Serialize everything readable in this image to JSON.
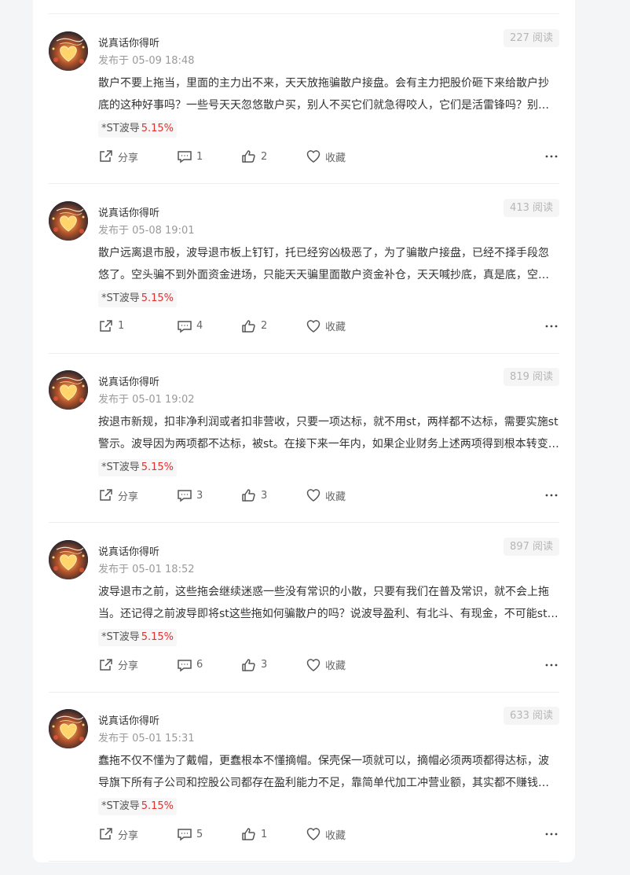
{
  "posts": [
    {
      "author": "说真话你得听",
      "time": "发布于 05-09 18:48",
      "reads": "227 阅读",
      "line1": "散户不要上拖当，里面的主力出不来，天天放拖骗散户接盘。会有主力把股价砸下来给散户抄",
      "line2": "底的这种好事吗？一些号天天忽悠散户买，别人不买它们就急得咬人，它们是活雷锋吗？别人不买它们",
      "stock": "*ST波导",
      "pct": "5.15%",
      "share": "分享",
      "comments": "1",
      "likes": "2",
      "collect": "收藏"
    },
    {
      "author": "说真话你得听",
      "time": "发布于 05-08 19:01",
      "reads": "413 阅读",
      "line1": "散户远离退市股，波导退市板上钉钉，托已经穷凶极恶了，为了骗散户接盘，已经不择手段忽",
      "line2": "悠了。空头骗不到外面资金进场，只能天天骗里面散户资金补仓，天天喊抄底，真是底，空头自己",
      "stock": "*ST波导",
      "pct": "5.15%",
      "share": "1",
      "comments": "4",
      "likes": "2",
      "collect": "收藏"
    },
    {
      "author": "说真话你得听",
      "time": "发布于 05-01 19:02",
      "reads": "819 阅读",
      "line1": "按退市新规，扣非净利润或者扣非营收，只要一项达标，就不用st，两样都不达标，需要实施st",
      "line2": "警示。波导因为两项都不达标，被st。在接下来一年内，如果企业财务上述两项得到根本转变，才能",
      "stock": "*ST波导",
      "pct": "5.15%",
      "share": "分享",
      "comments": "3",
      "likes": "3",
      "collect": "收藏"
    },
    {
      "author": "说真话你得听",
      "time": "发布于 05-01 18:52",
      "reads": "897 阅读",
      "line1": "波导退市之前，这些拖会继续迷惑一些没有常识的小散，只要有我们在普及常识，就不会上拖",
      "line2": "当。还记得之前波导即将st这些拖如何骗散户的吗？说波导盈利、有北斗、有现金，不可能st，结果",
      "stock": "*ST波导",
      "pct": "5.15%",
      "share": "分享",
      "comments": "6",
      "likes": "3",
      "collect": "收藏"
    },
    {
      "author": "说真话你得听",
      "time": "发布于 05-01 15:31",
      "reads": "633 阅读",
      "line1": "蠢拖不仅不懂为了戴帽，更蠢根本不懂摘帽。保壳保一项就可以，摘帽必须两项都得达标，波",
      "line2": "导旗下所有子公司和控股公司都存在盈利能力不足，靠简单代加工冲营业额，其实都不赚钱，亏损",
      "stock": "*ST波导",
      "pct": "5.15%",
      "share": "分享",
      "comments": "5",
      "likes": "1",
      "collect": "收藏"
    }
  ]
}
